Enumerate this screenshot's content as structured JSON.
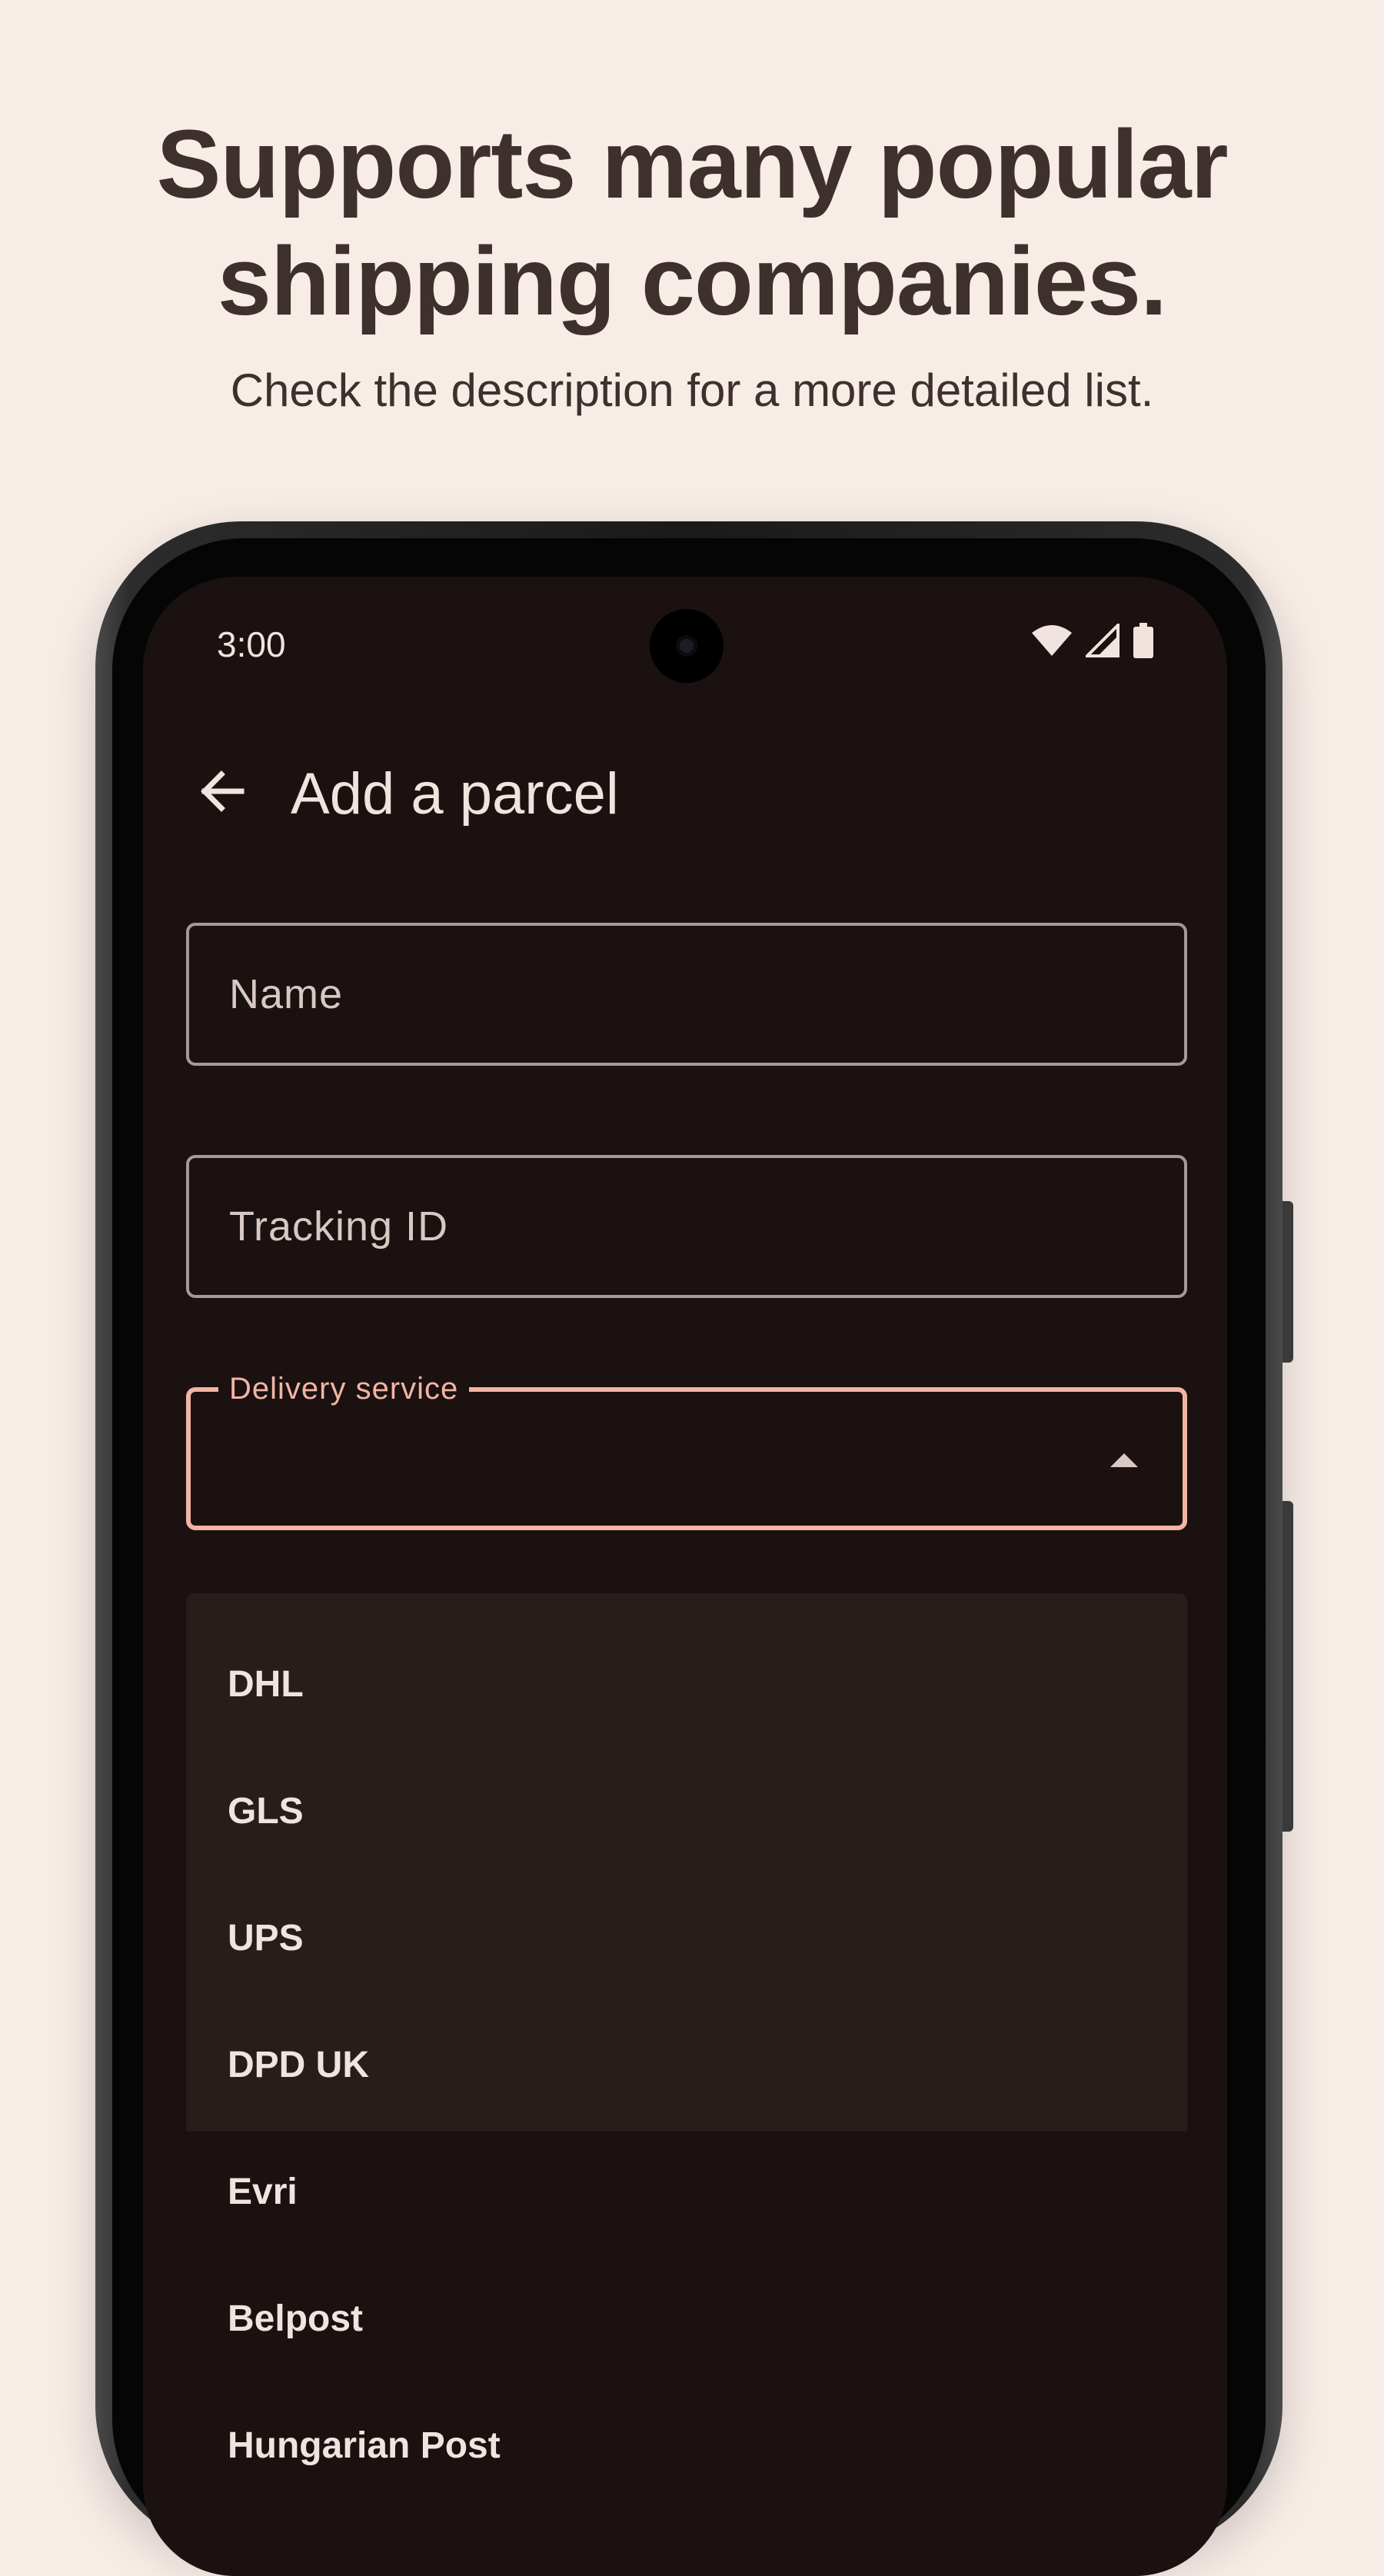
{
  "promo": {
    "headline_line1": "Supports many popular",
    "headline_line2": "shipping companies.",
    "subline": "Check the description for a more detailed list."
  },
  "status_bar": {
    "time": "3:00",
    "icons": [
      "wifi-icon",
      "signal-icon",
      "battery-icon"
    ]
  },
  "app_bar": {
    "back_icon": "arrow-back-icon",
    "title": "Add a parcel"
  },
  "form": {
    "name_placeholder": "Name",
    "tracking_placeholder": "Tracking ID",
    "delivery_label": "Delivery service",
    "delivery_value": ""
  },
  "menu": {
    "items": [
      "DHL",
      "GLS",
      "UPS",
      "DPD UK",
      "Evri",
      "Belpost",
      "Hungarian Post"
    ]
  },
  "colors": {
    "page_background": "#f8ece7",
    "headline_text": "#3e302c",
    "screen_background": "#1a1110",
    "menu_background": "#271d1b",
    "accent": "#f2b4a3",
    "outline": "#a59a96"
  }
}
